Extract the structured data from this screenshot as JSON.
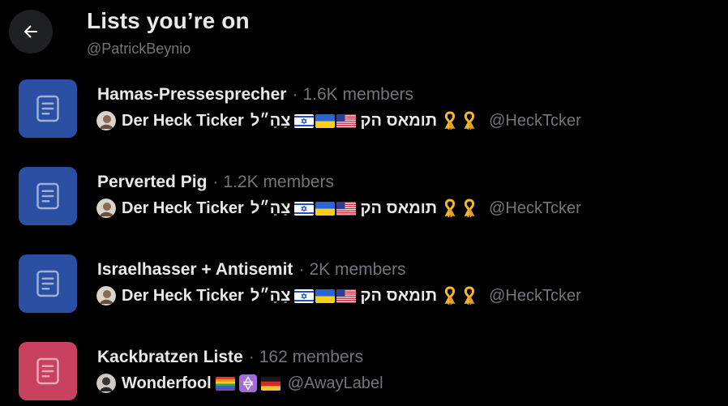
{
  "header": {
    "title": "Lists you’re on",
    "handle": "@PatrickBeynio"
  },
  "colors": {
    "list_icon_blue": "#2a4fa3",
    "list_icon_pink": "#c8415e",
    "muted_text": "#71767b"
  },
  "lists": [
    {
      "name": "Hamas-Pressesprecher",
      "separator": "·",
      "members": "1.6K members",
      "icon_color": "#2a4fa3",
      "owner": {
        "name": "Der Heck Ticker",
        "name_hebrew_1": "צַהַ״ל",
        "name_hebrew_2": "תומאס הק",
        "handle": "@HeckTcker"
      }
    },
    {
      "name": "Perverted Pig",
      "separator": "·",
      "members": "1.2K members",
      "icon_color": "#2a4fa3",
      "owner": {
        "name": "Der Heck Ticker",
        "name_hebrew_1": "צַהַ״ל",
        "name_hebrew_2": "תומאס הק",
        "handle": "@HeckTcker"
      }
    },
    {
      "name": "Israelhasser + Antisemit",
      "separator": "·",
      "members": "2K members",
      "icon_color": "#2a4fa3",
      "owner": {
        "name": "Der Heck Ticker",
        "name_hebrew_1": "צַהַ״ל",
        "name_hebrew_2": "תומאס הק",
        "handle": "@HeckTcker"
      }
    },
    {
      "name": "Kackbratzen Liste",
      "separator": "·",
      "members": "162 members",
      "icon_color": "#c8415e",
      "owner": {
        "name": "Wonderfool",
        "handle": "@AwayLabel"
      }
    }
  ]
}
